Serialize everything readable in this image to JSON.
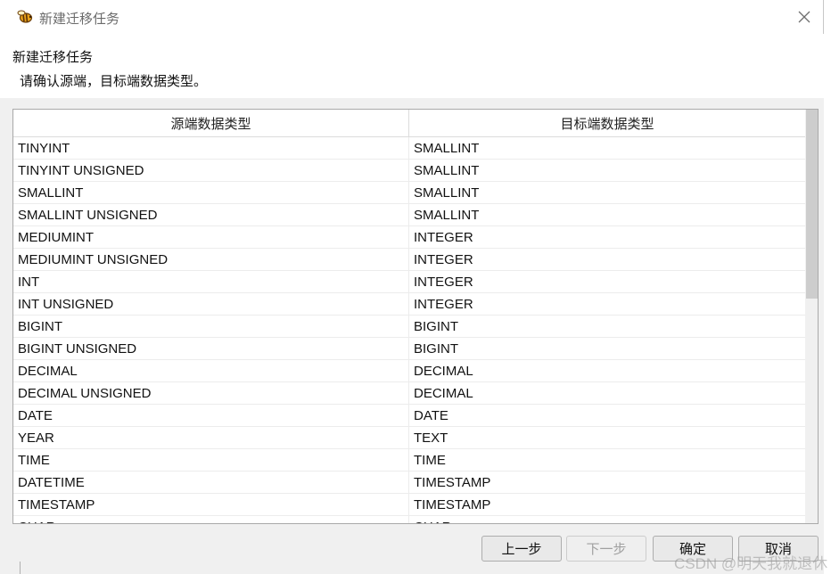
{
  "window": {
    "title": "新建迁移任务",
    "app_icon": "bee-icon",
    "close_icon": "close-icon"
  },
  "header": {
    "title": "新建迁移任务",
    "subtitle": "请确认源端，目标端数据类型。"
  },
  "table": {
    "columns": [
      "源端数据类型",
      "目标端数据类型"
    ],
    "rows": [
      [
        "TINYINT",
        "SMALLINT"
      ],
      [
        "TINYINT UNSIGNED",
        "SMALLINT"
      ],
      [
        "SMALLINT",
        "SMALLINT"
      ],
      [
        "SMALLINT UNSIGNED",
        "SMALLINT"
      ],
      [
        "MEDIUMINT",
        "INTEGER"
      ],
      [
        "MEDIUMINT UNSIGNED",
        "INTEGER"
      ],
      [
        "INT",
        "INTEGER"
      ],
      [
        "INT UNSIGNED",
        "INTEGER"
      ],
      [
        "BIGINT",
        "BIGINT"
      ],
      [
        "BIGINT UNSIGNED",
        "BIGINT"
      ],
      [
        "DECIMAL",
        "DECIMAL"
      ],
      [
        "DECIMAL UNSIGNED",
        "DECIMAL"
      ],
      [
        "DATE",
        "DATE"
      ],
      [
        "YEAR",
        "TEXT"
      ],
      [
        "TIME",
        "TIME"
      ],
      [
        "DATETIME",
        "TIMESTAMP"
      ],
      [
        "TIMESTAMP",
        "TIMESTAMP"
      ],
      [
        "CHAR",
        "CHAR"
      ]
    ]
  },
  "buttons": {
    "prev": "上一步",
    "next": "下一步",
    "ok": "确定",
    "cancel": "取消"
  },
  "watermark": "CSDN @明天我就退休",
  "colors": {
    "content_bg": "#f0f0f0",
    "border": "#a9a9a9",
    "disabled_text": "#a0a0a0"
  }
}
